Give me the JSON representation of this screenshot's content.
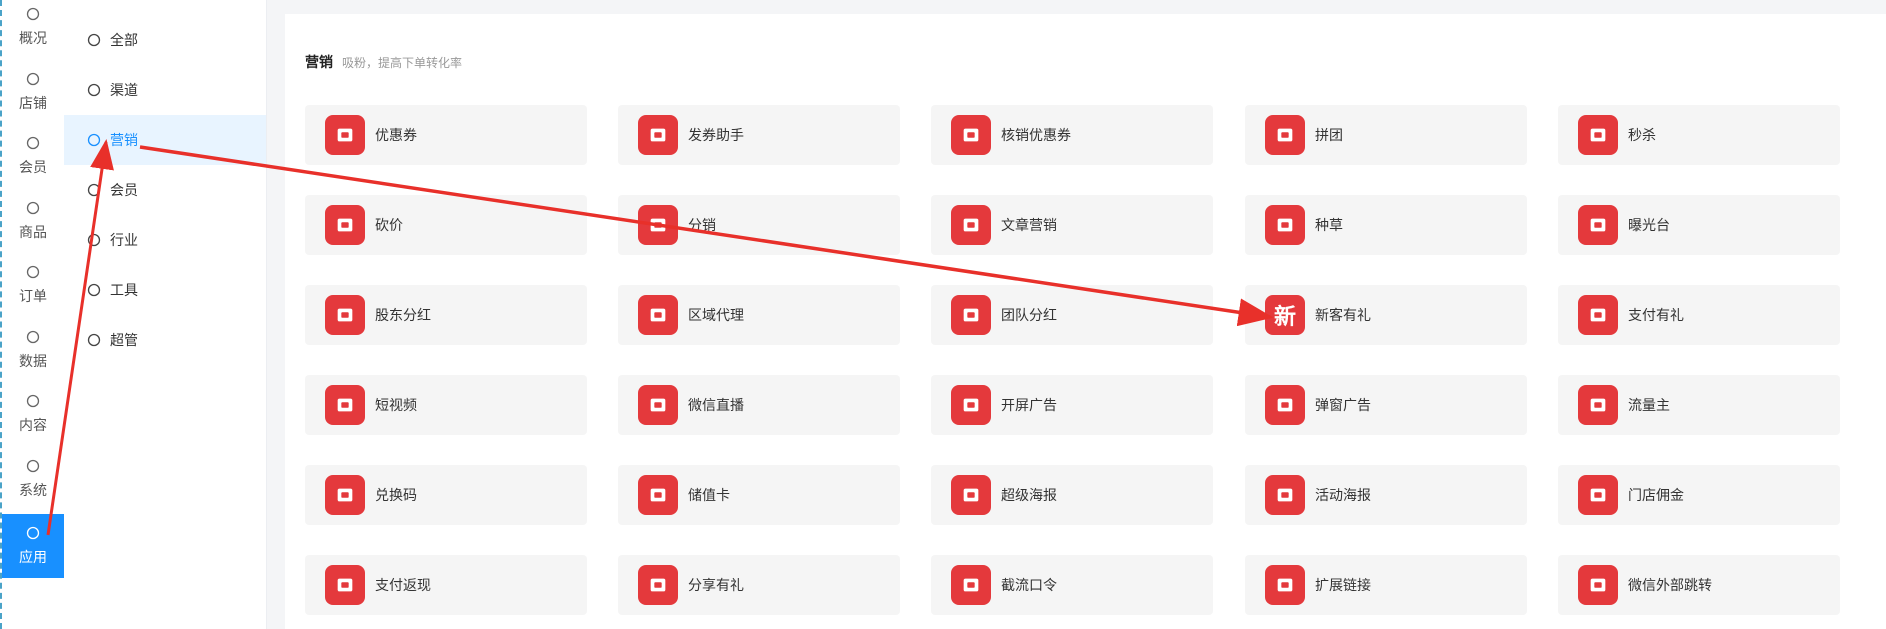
{
  "rail": [
    {
      "label": "概况",
      "icon": "gauge-icon"
    },
    {
      "label": "店铺",
      "icon": "store-icon"
    },
    {
      "label": "会员",
      "icon": "user-icon"
    },
    {
      "label": "商品",
      "icon": "box-icon"
    },
    {
      "label": "订单",
      "icon": "clipboard-icon"
    },
    {
      "label": "数据",
      "icon": "pie-icon"
    },
    {
      "label": "内容",
      "icon": "folder-icon"
    },
    {
      "label": "系统",
      "icon": "gear-icon"
    },
    {
      "label": "应用",
      "icon": "cube-icon",
      "active": true
    }
  ],
  "submenu": [
    {
      "label": "全部",
      "icon": "cube-icon"
    },
    {
      "label": "渠道",
      "icon": "channel-icon"
    },
    {
      "label": "营销",
      "icon": "trend-icon",
      "active": true
    },
    {
      "label": "会员",
      "icon": "user-icon"
    },
    {
      "label": "行业",
      "icon": "briefcase-icon"
    },
    {
      "label": "工具",
      "icon": "wrench-icon"
    },
    {
      "label": "超管",
      "icon": "admin-icon"
    }
  ],
  "section": {
    "title": "营销",
    "subtitle": "吸粉，提高下单转化率"
  },
  "cards": [
    [
      "优惠券",
      "发券助手",
      "核销优惠券",
      "拼团",
      "秒杀"
    ],
    [
      "砍价",
      "分销",
      "文章营销",
      "种草",
      "曝光台"
    ],
    [
      "股东分红",
      "区域代理",
      "团队分红",
      "新客有礼",
      "支付有礼"
    ],
    [
      "短视频",
      "微信直播",
      "开屏广告",
      "弹窗广告",
      "流量主"
    ],
    [
      "兑换码",
      "储值卡",
      "超级海报",
      "活动海报",
      "门店佣金"
    ],
    [
      "支付返现",
      "分享有礼",
      "截流口令",
      "扩展链接",
      "微信外部跳转"
    ]
  ],
  "card_icons": [
    [
      "coupon-icon",
      "coupon-helper-icon",
      "verify-coupon-icon",
      "group-buy-icon",
      "flash-sale-icon"
    ],
    [
      "bargain-icon",
      "distribution-icon",
      "article-icon",
      "seed-icon",
      "exposure-icon"
    ],
    [
      "shareholder-icon",
      "region-icon",
      "team-bonus-icon",
      "new-customer-icon",
      "pay-gift-icon"
    ],
    [
      "video-icon",
      "live-icon",
      "splash-ad-icon",
      "popup-ad-icon",
      "traffic-icon"
    ],
    [
      "redeem-code-icon",
      "stored-card-icon",
      "poster-icon",
      "event-poster-icon",
      "store-commission-icon"
    ],
    [
      "cashback-icon",
      "share-gift-icon",
      "intercept-icon",
      "extend-link-icon",
      "wechat-jump-icon"
    ]
  ],
  "new_glyph": "新",
  "colors": {
    "accent": "#1890ff",
    "icon_bg": "#e4393c",
    "arrow": "#e8302a"
  }
}
